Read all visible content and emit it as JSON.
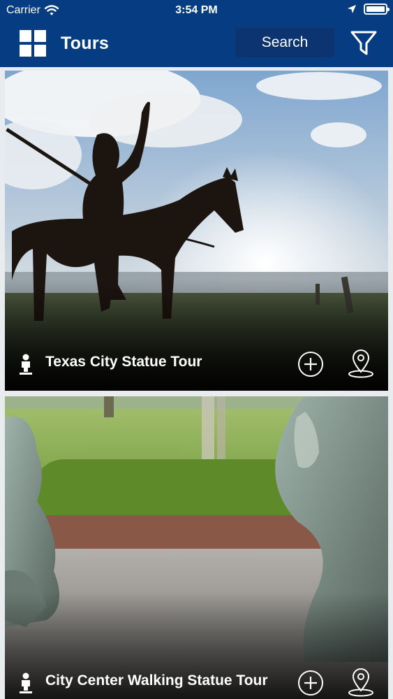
{
  "status_bar": {
    "carrier": "Carrier",
    "time": "3:54 PM"
  },
  "nav": {
    "title": "Tours",
    "search_label": "Search",
    "menu_icon": "grid-menu-icon",
    "filter_icon": "filter-icon"
  },
  "colors": {
    "nav_background": "#063d82",
    "search_background": "#0b3470",
    "text": "#ffffff"
  },
  "tours": [
    {
      "title": "Texas City Statue Tour",
      "image": "silhouette of a horse-and-rider statue against the sky and bay",
      "type_icon": "person-icon",
      "add_icon": "add-circle-icon",
      "map_icon": "map-pin-icon"
    },
    {
      "title": "City Center Walking Statue Tour",
      "image": "bronze statues of children in a park",
      "type_icon": "person-icon",
      "add_icon": "add-circle-icon",
      "map_icon": "map-pin-icon"
    }
  ]
}
